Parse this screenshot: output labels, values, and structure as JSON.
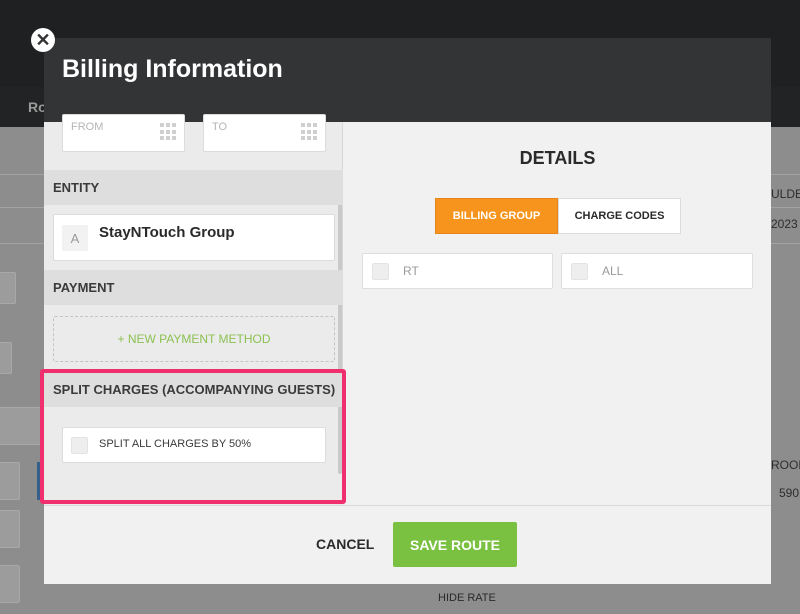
{
  "background": {
    "tab_partial": "Ro",
    "col_partial": "ULDER",
    "year_partial": "2023",
    "room_partial": "ROOM",
    "room_number_partial": "590",
    "hide_rate": "HIDE RATE"
  },
  "modal": {
    "title": "Billing Information",
    "close_icon": "close-icon",
    "dates": {
      "from_placeholder": "FROM",
      "to_placeholder": "TO"
    },
    "entity": {
      "header": "ENTITY",
      "letter": "A",
      "name": "StayNTouch Group"
    },
    "payment": {
      "header": "PAYMENT",
      "new_method": "+ NEW PAYMENT METHOD"
    },
    "split": {
      "header": "SPLIT CHARGES (ACCOMPANYING GUESTS)",
      "option_label": "SPLIT ALL CHARGES BY 50%",
      "checked": false
    },
    "details": {
      "title": "DETAILS",
      "tabs": [
        {
          "label": "BILLING GROUP",
          "active": true
        },
        {
          "label": "CHARGE CODES",
          "active": false
        }
      ],
      "codes": [
        {
          "label": "RT",
          "checked": false
        },
        {
          "label": "ALL",
          "checked": false
        }
      ]
    },
    "footer": {
      "cancel": "CANCEL",
      "save": "SAVE ROUTE"
    }
  },
  "colors": {
    "accent_orange": "#f7941d",
    "save_green": "#7ac142",
    "highlight_pink": "#f0306e",
    "new_payment_green": "#8cc152"
  }
}
